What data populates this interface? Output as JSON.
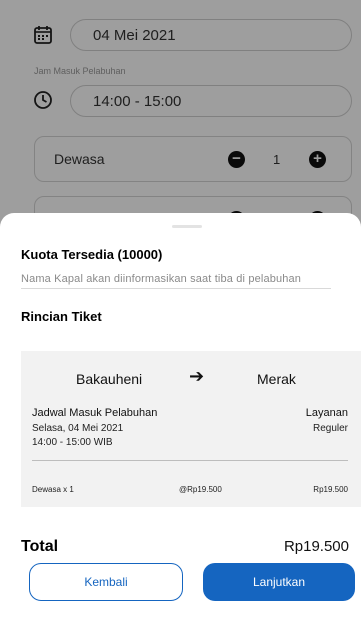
{
  "background_form": {
    "date_value": "04 Mei 2021",
    "port_time_label": "Jam Masuk Pelabuhan",
    "time_value": "14:00 - 15:00",
    "passenger_type": "Dewasa",
    "passenger_count": "1"
  },
  "sheet": {
    "quota": "Kuota Tersedia (10000)",
    "ship_info": "Nama Kapal akan diinformasikan saat tiba di pelabuhan",
    "section_title": "Rincian Tiket",
    "ticket": {
      "origin": "Bakauheni",
      "destination": "Merak",
      "schedule_label": "Jadwal Masuk Pelabuhan",
      "schedule_date": "Selasa, 04 Mei 2021",
      "schedule_time": "14:00 - 15:00 WIB",
      "service_label": "Layanan",
      "service_value": "Reguler",
      "line_item": "Dewasa x 1",
      "unit_price": "@Rp19.500",
      "line_total": "Rp19.500"
    },
    "total_label": "Total",
    "total_value": "Rp19.500",
    "back_button": "Kembali",
    "next_button": "Lanjutkan"
  },
  "colors": {
    "primary": "#1565c0",
    "overlay": "rgba(0,0,0,0.38)"
  }
}
